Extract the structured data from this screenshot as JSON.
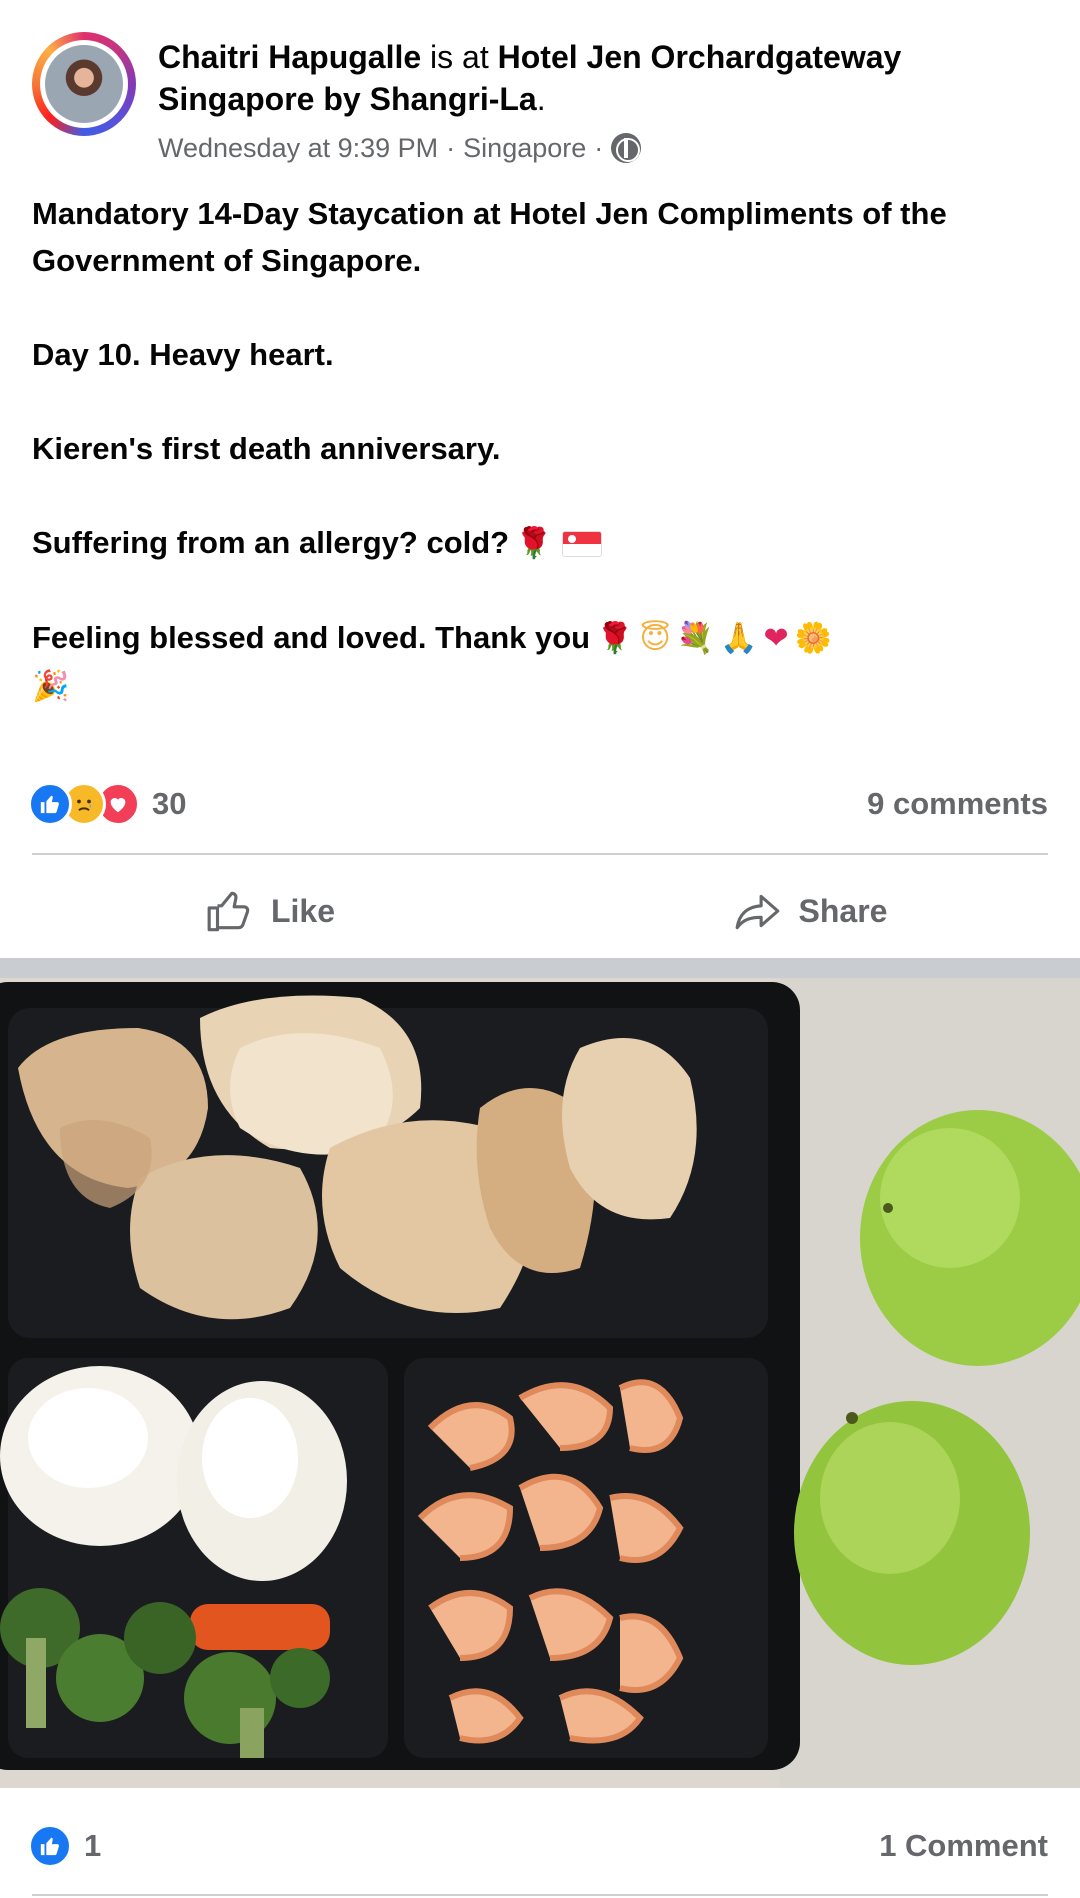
{
  "post": {
    "author": "Chaitri Hapugalle",
    "is_at": "is at",
    "place": "Hotel Jen Orchardgateway Singapore by Shangri-La",
    "place_end": ".",
    "time": "Wednesday at 9:39 PM",
    "location": "Singapore",
    "separator": "·",
    "privacy_icon": "globe-icon",
    "paragraphs": [
      "Mandatory 14-Day Staycation at Hotel Jen Compliments of the Government of Singapore.",
      "Day 10.  Heavy heart.",
      "Kieren's first death anniversary.",
      "Suffering from an allergy? cold?",
      "Feeling blessed and loved. Thank you"
    ],
    "emojis": {
      "rose": "🌹",
      "halo": "😇",
      "bouquet": "💐",
      "pray": "🙏",
      "heart": "❤",
      "flower": "🌼",
      "party": "🎉"
    },
    "reactions": {
      "icons": [
        "like-reaction-icon",
        "sad-reaction-icon",
        "love-reaction-icon"
      ],
      "count": "30",
      "comments": "9 comments"
    },
    "actions": {
      "like": "Like",
      "share": "Share"
    }
  },
  "next_post": {
    "reaction_icon": "like-reaction-icon",
    "reaction_count": "1",
    "comments": "1 Comment"
  },
  "colors": {
    "like_blue": "#1877f2",
    "secondary_text": "#65676b",
    "divider": "#ced0d4"
  }
}
